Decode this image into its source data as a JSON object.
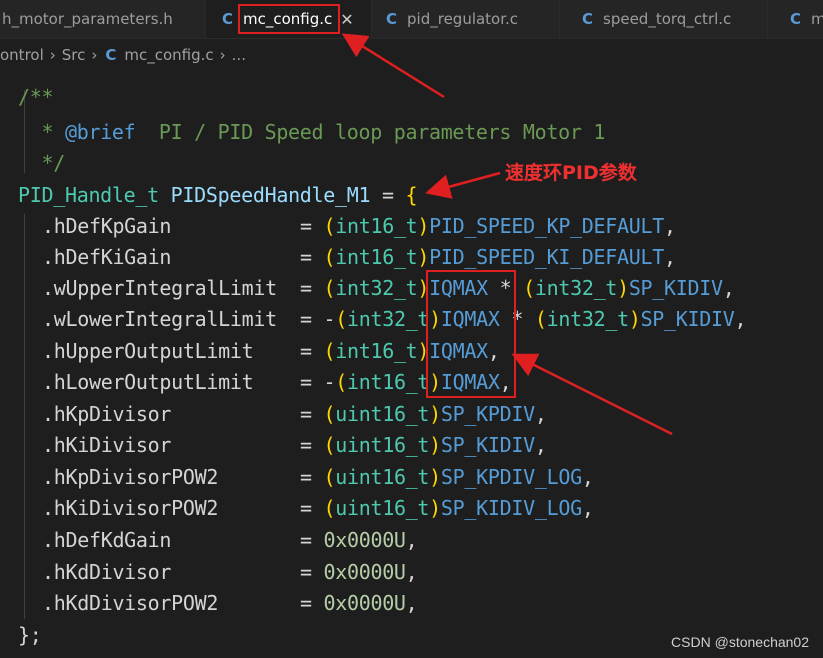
{
  "tabs": [
    {
      "label": "h_motor_parameters.h",
      "icon": "none",
      "active": false
    },
    {
      "label": "mc_config.c",
      "icon": "c-file-icon",
      "active": true
    },
    {
      "label": "pid_regulator.c",
      "icon": "c-file-icon",
      "active": false
    },
    {
      "label": "speed_torq_ctrl.c",
      "icon": "c-file-icon",
      "active": false
    },
    {
      "label": "m",
      "icon": "c-file-icon",
      "active": false
    }
  ],
  "tab_icon_glyph": "C",
  "close_glyph": "✕",
  "breadcrumb": [
    "ontrol",
    "Src",
    "mc_config.c",
    "..."
  ],
  "code": {
    "l1": "/**",
    "l2_star": "  * ",
    "l2_tag": "@brief",
    "l2_text": "  PI / PID Speed loop parameters Motor 1",
    "l3": "  */",
    "decl_type": "PID_Handle_t",
    "decl_var": "PIDSpeedHandle_M1",
    "decl_eq": " = ",
    "decl_brace": "{",
    "close": "};",
    "fields": [
      {
        "name": ".hDefKpGain",
        "eq": "= ",
        "cast": "int16_t",
        "expr": "PID_SPEED_KP_DEFAULT",
        "tail": ","
      },
      {
        "name": ".hDefKiGain",
        "eq": "= ",
        "cast": "int16_t",
        "expr": "PID_SPEED_KI_DEFAULT",
        "tail": ","
      },
      {
        "name": ".wUpperIntegralLimit",
        "eq": "= ",
        "cast": "int32_t",
        "expr": "IQMAX",
        "mul": " * ",
        "cast2": "int32_t",
        "expr2": "SP_KIDIV",
        "tail": ","
      },
      {
        "name": ".wLowerIntegralLimit",
        "eq": "= -",
        "cast": "int32_t",
        "expr": "IQMAX",
        "mul": " * ",
        "cast2": "int32_t",
        "expr2": "SP_KIDIV",
        "tail": ","
      },
      {
        "name": ".hUpperOutputLimit",
        "eq": "= ",
        "cast": "int16_t",
        "expr": "IQMAX",
        "tail": ","
      },
      {
        "name": ".hLowerOutputLimit",
        "eq": "= -",
        "cast": "int16_t",
        "expr": "IQMAX",
        "tail": ","
      },
      {
        "name": ".hKpDivisor",
        "eq": "= ",
        "cast": "uint16_t",
        "expr": "SP_KPDIV",
        "tail": ","
      },
      {
        "name": ".hKiDivisor",
        "eq": "= ",
        "cast": "uint16_t",
        "expr": "SP_KIDIV",
        "tail": ","
      },
      {
        "name": ".hKpDivisorPOW2",
        "eq": "= ",
        "cast": "uint16_t",
        "expr": "SP_KPDIV_LOG",
        "tail": ","
      },
      {
        "name": ".hKiDivisorPOW2",
        "eq": "= ",
        "cast": "uint16_t",
        "expr": "SP_KIDIV_LOG",
        "tail": ","
      },
      {
        "name": ".hDefKdGain",
        "eq": "= ",
        "num": "0x0000U",
        "tail": ","
      },
      {
        "name": ".hKdDivisor",
        "eq": "= ",
        "num": "0x0000U",
        "tail": ","
      },
      {
        "name": ".hKdDivisorPOW2",
        "eq": "= ",
        "num": "0x0000U",
        "tail": ","
      }
    ]
  },
  "annotation_label": "速度环PID参数",
  "watermark": "CSDN @stonechan02",
  "colors": {
    "annotation": "#e02020",
    "comment": "#6a9955",
    "keyword": "#569cd6",
    "type": "#4ec9b0",
    "variable": "#9cdcfe",
    "paren": "#ffd700",
    "number": "#b5cea8"
  }
}
